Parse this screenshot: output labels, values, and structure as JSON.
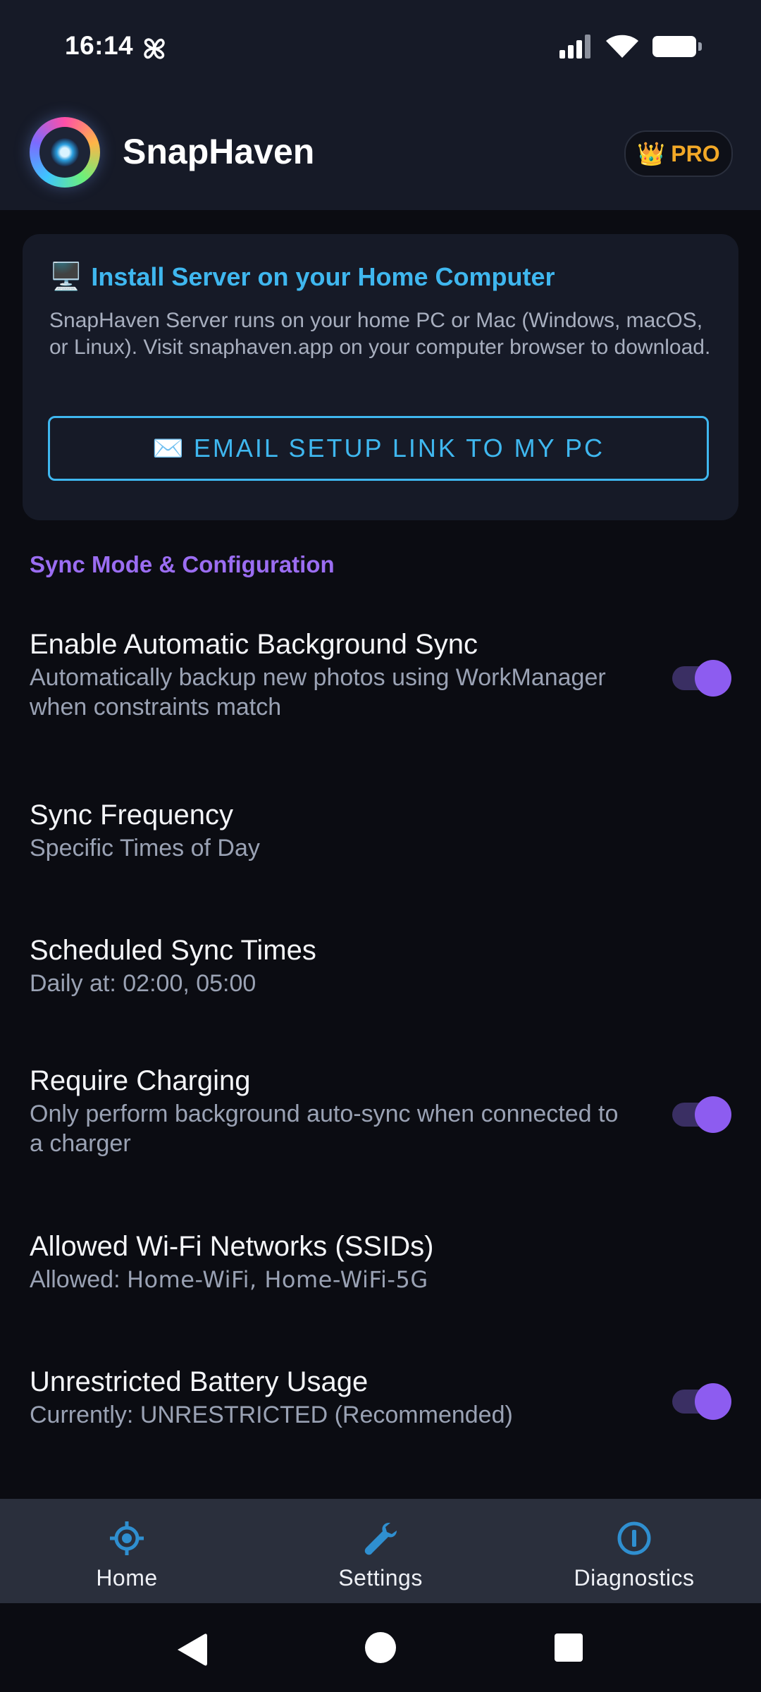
{
  "status_bar": {
    "time": "16:14",
    "icons": [
      "app-notification-icon",
      "signal-icon",
      "wifi-icon",
      "battery-icon"
    ]
  },
  "app_bar": {
    "logo_icon": "camera-aperture-logo",
    "title": "SnapHaven",
    "pro_badge": {
      "icon": "crown-icon",
      "label": "PRO"
    }
  },
  "install_card": {
    "icon": "desktop-computer-icon",
    "title": "Install Server on your Home Computer",
    "description": "SnapHaven Server runs on your home PC or Mac (Windows, macOS, or Linux). Visit snaphaven.app on your computer browser to download.",
    "button": {
      "icon": "envelope-icon",
      "label": "EMAIL SETUP LINK TO MY PC"
    }
  },
  "section": {
    "title": "Sync Mode & Configuration"
  },
  "settings": [
    {
      "title": "Enable Automatic Background Sync",
      "subtitle": "Automatically backup new photos using WorkManager when constraints match",
      "toggle": true
    },
    {
      "title": "Sync Frequency",
      "subtitle": "Specific Times of Day"
    },
    {
      "title": "Scheduled Sync Times",
      "subtitle": "Daily at: 02:00, 05:00"
    },
    {
      "title": "Require Charging",
      "subtitle": "Only perform background auto-sync when connected to a charger",
      "toggle": true
    },
    {
      "title": "Allowed Wi-Fi Networks (SSIDs)",
      "subtitle_prefix": "Allowed:",
      "subtitle_value": "Home-WiFi, Home-WiFi-5G"
    },
    {
      "title": "Unrestricted Battery Usage",
      "subtitle": "Currently: UNRESTRICTED (Recommended)",
      "toggle": true
    }
  ],
  "bottom_nav": {
    "items": [
      {
        "label": "Home",
        "icon": "crosshair-icon"
      },
      {
        "label": "Settings",
        "icon": "wrench-icon"
      },
      {
        "label": "Diagnostics",
        "icon": "info-circle-icon"
      }
    ]
  },
  "system_nav": [
    "back-icon",
    "home-icon",
    "recents-icon"
  ],
  "colors": {
    "background": "#0b0c12",
    "surface": "#161a27",
    "accent_blue": "#3fb7ef",
    "accent_purple": "#9b6df2",
    "pro_gold": "#f2a827",
    "toggle_on": "#8d5cf0"
  }
}
